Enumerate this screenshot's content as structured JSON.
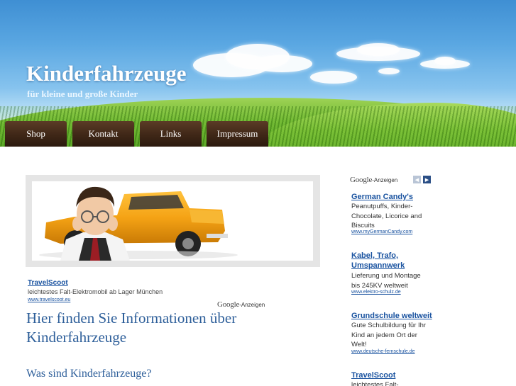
{
  "site": {
    "title": "Kinderfahrzeuge",
    "subtitle": "für kleine und große Kinder"
  },
  "nav": {
    "items": [
      {
        "label": "Shop"
      },
      {
        "label": "Kontakt"
      },
      {
        "label": "Links"
      },
      {
        "label": "Impressum"
      }
    ]
  },
  "main_ad": {
    "title": "TravelScoot",
    "text": "leichtestes Falt-Elektromobil ab Lager München",
    "url": "www.travelscoot.eu",
    "google_word": "Google",
    "google_suffix": "-Anzeigen"
  },
  "content": {
    "heading": "Hier finden Sie Informationen über Kinderfahrzeuge",
    "subheading": "Was sind Kinderfahrzeuge?"
  },
  "sidebar": {
    "google_word": "Google",
    "google_suffix": "-Anzeigen",
    "ads": [
      {
        "title": "German Candy's",
        "text": "Peanutpuffs, Kinder-Chocolate, Licorice and Biscuits",
        "url": "www.myGermanCandy.com"
      },
      {
        "title": "Kabel, Trafo, Umspannwerk",
        "text": "Lieferung und Montage bis 245KV weltweit",
        "url": "www.elektro-schulz.de"
      },
      {
        "title": "Grundschule weltweit",
        "text": "Gute Schulbildung für Ihr Kind an jedem Ort der Welt!",
        "url": "www.deutsche-fernschule.de"
      },
      {
        "title": "TravelScoot",
        "text": "leichtestes Falt-",
        "url": ""
      }
    ]
  },
  "colors": {
    "link": "#1a53a0",
    "heading": "#2e5f9a",
    "nav_bg": "#3f2717",
    "banner_border": "#e5e5e5"
  },
  "icons": {
    "prev": "chevron-left-icon",
    "next": "chevron-right-icon"
  }
}
